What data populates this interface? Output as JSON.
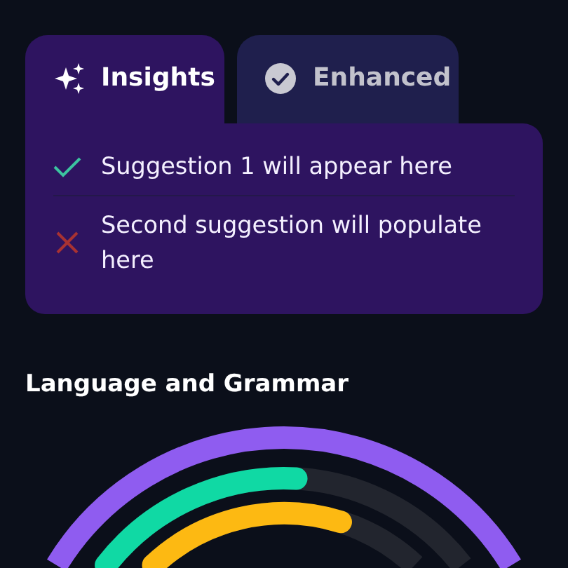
{
  "tabs": [
    {
      "label": "Insights",
      "selected": true
    },
    {
      "label": "Enhanced",
      "selected": false
    }
  ],
  "suggestions": [
    {
      "text": "Suggestion 1 will appear here",
      "kind": "accepted"
    },
    {
      "text": "Second suggestion will populate here",
      "kind": "rejected"
    }
  ],
  "section": {
    "title": "Language and Grammar"
  },
  "rings": [
    {
      "kind": "border",
      "color": "#8f5cf0"
    },
    {
      "kind": "meter",
      "level": 0.53,
      "color": "#10d9a4"
    },
    {
      "kind": "meter",
      "level": 0.7,
      "color": "#fdb912"
    }
  ]
}
